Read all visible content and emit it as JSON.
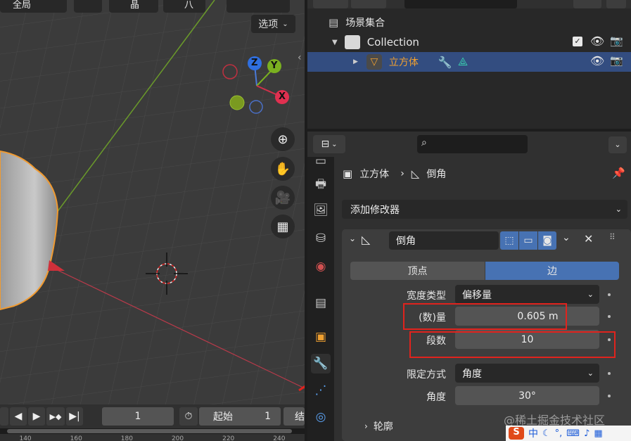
{
  "viewport": {
    "header_item_1": "全局",
    "header_item_2": "晶",
    "header_item_3": "八",
    "options_label": "选项",
    "gizmo": {
      "z": "Z",
      "y": "Y",
      "x": "X"
    },
    "nav_icons": [
      "zoom-icon",
      "hand-icon",
      "camera-icon",
      "grid-icon"
    ]
  },
  "timeline": {
    "frame_current": "1",
    "start_label": "起始",
    "start_value": "1",
    "end_label_partial": "结",
    "ruler": [
      "140",
      "160",
      "180",
      "200",
      "220",
      "240"
    ]
  },
  "outliner": {
    "scene_collection": "场景集合",
    "collection": "Collection",
    "object": "立方体"
  },
  "properties": {
    "breadcrumb_object": "立方体",
    "breadcrumb_modifier": "倒角",
    "add_modifier": "添加修改器",
    "modifier_name": "倒角",
    "tab_vertices": "顶点",
    "tab_edges": "边",
    "width_type_label": "宽度类型",
    "width_type_value": "偏移量",
    "amount_label": "(数)量",
    "amount_value": "0.605 m",
    "segments_label": "段数",
    "segments_value": "10",
    "limit_method_label": "限定方式",
    "limit_method_value": "角度",
    "angle_label": "角度",
    "angle_value": "30°",
    "profile_label": "轮廓"
  },
  "watermark": "@稀土掘金技术社区",
  "ime_bar": {
    "logo": "S",
    "lang": "中"
  },
  "colors": {
    "accent_blue": "#4772b3",
    "highlight_red": "#e0231d",
    "selected_row": "#334d80",
    "object_orange": "#f0a030"
  }
}
